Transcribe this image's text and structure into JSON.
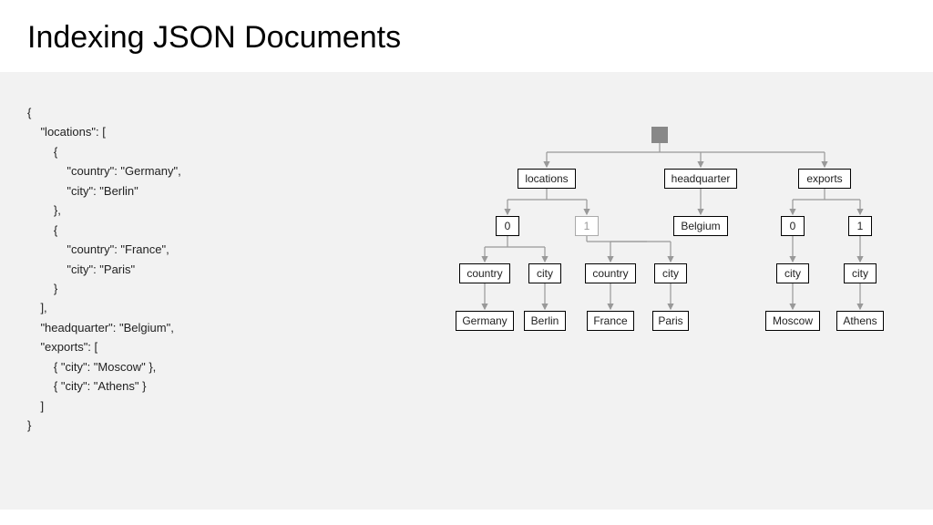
{
  "title": "Indexing JSON Documents",
  "code_lines": [
    "{",
    "    \"locations\": [",
    "        {",
    "            \"country\": \"Germany\",",
    "            \"city\": \"Berlin\"",
    "        },",
    "        {",
    "            \"country\": \"France\",",
    "            \"city\": \"Paris\"",
    "        }",
    "    ],",
    "    \"headquarter\": \"Belgium\",",
    "    \"exports\": [",
    "        { \"city\": \"Moscow\" },",
    "        { \"city\": \"Athens\" }",
    "    ]",
    "}"
  ],
  "nodes": {
    "row1": {
      "locations": "locations",
      "headquarter": "headquarter",
      "exports": "exports"
    },
    "row2": {
      "loc0": "0",
      "loc1": "1",
      "belgium": "Belgium",
      "exp0": "0",
      "exp1": "1"
    },
    "row3": {
      "country0": "country",
      "city0": "city",
      "country1": "country",
      "city1": "city",
      "city_exp0": "city",
      "city_exp1": "city"
    },
    "row4": {
      "germany": "Germany",
      "berlin": "Berlin",
      "france": "France",
      "paris": "Paris",
      "moscow": "Moscow",
      "athens": "Athens"
    }
  }
}
